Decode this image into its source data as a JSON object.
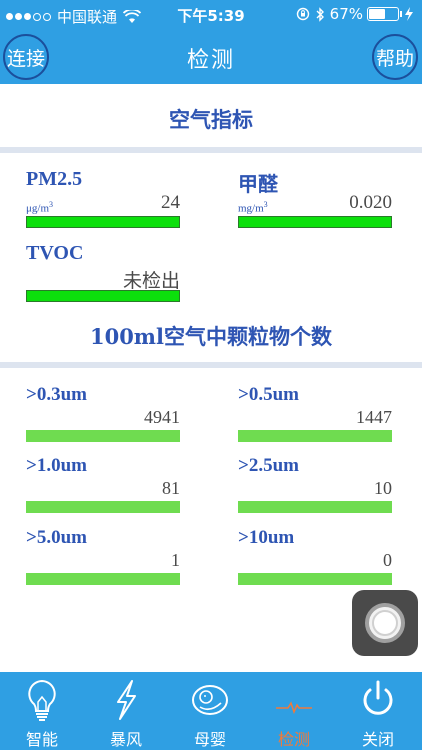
{
  "status_bar": {
    "carrier": "中国联通",
    "time": "下午5:39",
    "battery": "67%",
    "battery_level": 0.67
  },
  "nav": {
    "title": "检测",
    "left_button": "连接",
    "right_button": "帮助"
  },
  "air_section": {
    "title": "空气指标",
    "metrics": [
      {
        "name": "PM2.5",
        "unit": "μg/m",
        "unit_sup": "3",
        "value": "24"
      },
      {
        "name": "甲醛",
        "unit": "mg/m",
        "unit_sup": "3",
        "value": "0.020"
      },
      {
        "name": "TVOC",
        "unit": "",
        "unit_sup": "",
        "value": "未检出"
      }
    ]
  },
  "particle_section": {
    "title": "100ml空气中颗粒物个数",
    "items": [
      {
        "name": ">0.3um",
        "value": "4941"
      },
      {
        "name": ">0.5um",
        "value": "1447"
      },
      {
        "name": ">1.0um",
        "value": "81"
      },
      {
        "name": ">2.5um",
        "value": "10"
      },
      {
        "name": ">5.0um",
        "value": "1"
      },
      {
        "name": ">10um",
        "value": "0"
      }
    ]
  },
  "tabs": [
    {
      "label": "智能",
      "icon": "lightbulb-icon"
    },
    {
      "label": "暴风",
      "icon": "lightning-icon"
    },
    {
      "label": "母婴",
      "icon": "baby-icon"
    },
    {
      "label": "检测",
      "icon": "pulse-icon",
      "active": true
    },
    {
      "label": "关闭",
      "icon": "power-icon"
    }
  ],
  "colors": {
    "primary": "#2f9fe3",
    "label_blue": "#2e55b3",
    "bar_green": "#0ce00c",
    "bar_light_green": "#6fdc50",
    "active_tab": "#f07a3a"
  }
}
